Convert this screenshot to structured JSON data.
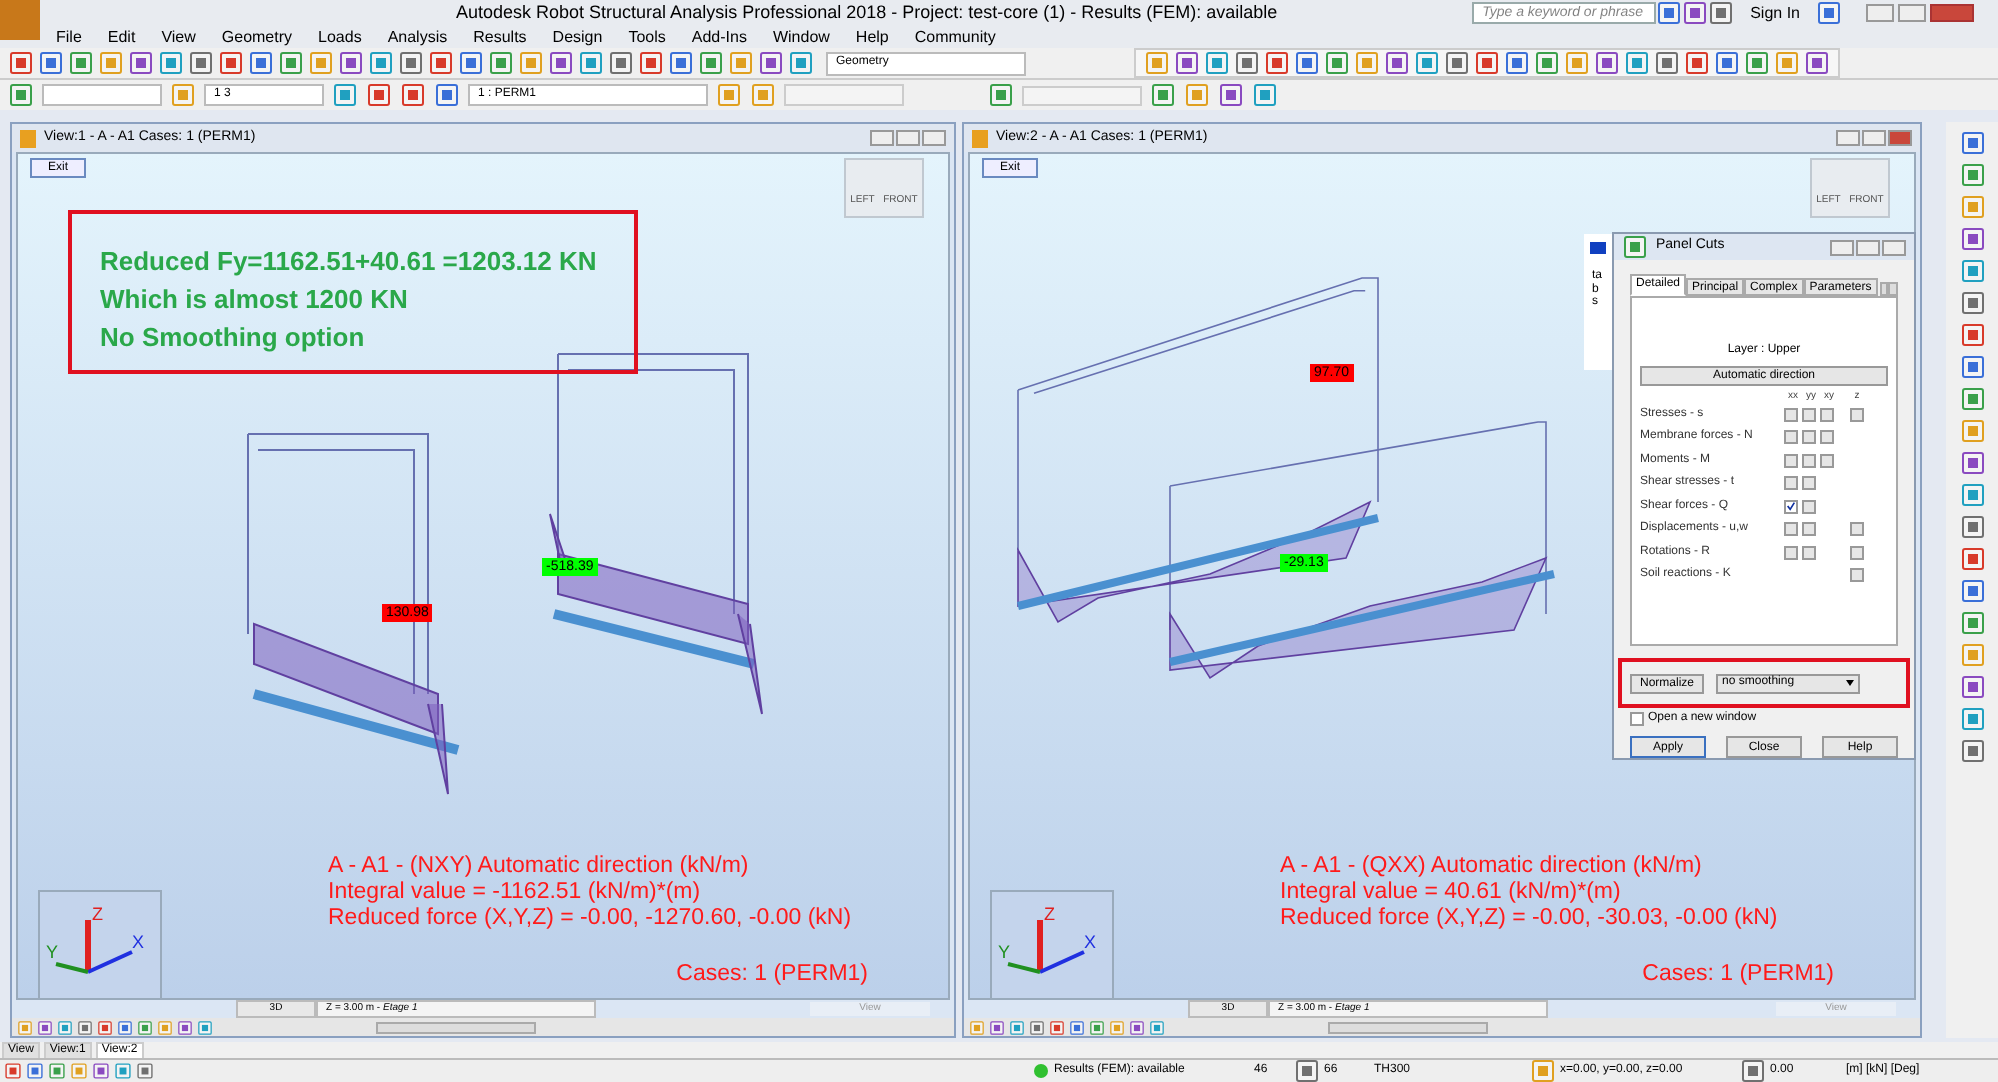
{
  "window": {
    "title": "Autodesk Robot Structural Analysis Professional 2018 - Project: test-core (1) - Results (FEM): available",
    "search_placeholder": "Type a keyword or phrase",
    "sign_in": "Sign In"
  },
  "menu": [
    "File",
    "Edit",
    "View",
    "Geometry",
    "Loads",
    "Analysis",
    "Results",
    "Design",
    "Tools",
    "Add-Ins",
    "Window",
    "Help",
    "Community"
  ],
  "toolbar": {
    "layout": "Geometry",
    "bar_combo": "1 3",
    "case_combo": "1 : PERM1"
  },
  "views": [
    {
      "title": "View:1 - A - A1 Cases: 1 (PERM1)",
      "exit": "Exit",
      "cube": [
        "LEFT",
        "FRONT"
      ],
      "annotation": [
        "Reduced Fy=1162.51+40.61 =1203.12 KN",
        "Which is almost 1200 KN",
        "No Smoothing option"
      ],
      "value_labels": [
        {
          "text": "130.98",
          "color": "#ff0000"
        },
        {
          "text": "-518.39",
          "color": "#00ff00"
        }
      ],
      "results": [
        "A - A1 - (NXY) Automatic direction (kN/m)",
        "Integral value = -1162.51 (kN/m)*(m)",
        "Reduced force (X,Y,Z) = -0.00, -1270.60, -0.00 (kN)"
      ],
      "cases": "Cases: 1 (PERM1)",
      "axes": [
        "X",
        "Y",
        "Z"
      ],
      "mode": "3D",
      "level": "Z = 3.00 m - *Etage 1*",
      "view_label": "View"
    },
    {
      "title": "View:2 - A - A1 Cases: 1 (PERM1)",
      "exit": "Exit",
      "cube": [
        "LEFT",
        "FRONT"
      ],
      "value_labels": [
        {
          "text": "97.70",
          "color": "#ff0000"
        },
        {
          "text": "-29.13",
          "color": "#00ff00"
        }
      ],
      "results": [
        "A - A1 - (QXX) Automatic direction (kN/m)",
        "Integral value = 40.61 (kN/m)*(m)",
        "Reduced force (X,Y,Z) = -0.00, -30.03, -0.00 (kN)"
      ],
      "cases": "Cases: 1 (PERM1)",
      "axes": [
        "X",
        "Y",
        "Z"
      ],
      "mode": "3D",
      "level": "Z = 3.00 m - *Etage 1*",
      "view_label": "View"
    }
  ],
  "panel_cuts": {
    "title": "Panel Cuts",
    "side_tab": "tabs",
    "tabs": [
      {
        "label": "Detailed",
        "selected": true
      },
      {
        "label": "Principal",
        "selected": false
      },
      {
        "label": "Complex",
        "selected": false
      },
      {
        "label": "Parameters",
        "selected": false
      }
    ],
    "layer": "Layer : Upper",
    "auto_button": "Automatic direction",
    "columns": [
      "xx",
      "yy",
      "xy",
      "z"
    ],
    "rows": [
      {
        "label": "Stresses - s",
        "cells": [
          {
            "checked": false
          },
          {
            "checked": false
          },
          {
            "checked": false
          },
          {
            "checked": false
          }
        ]
      },
      {
        "label": "Membrane forces - N",
        "cells": [
          {
            "checked": false
          },
          {
            "checked": false
          },
          {
            "checked": false
          },
          null
        ]
      },
      {
        "label": "Moments - M",
        "cells": [
          {
            "checked": false
          },
          {
            "checked": false
          },
          {
            "checked": false
          },
          null
        ]
      },
      {
        "label": "Shear stresses - t",
        "cells": [
          {
            "checked": false
          },
          {
            "checked": false
          },
          null,
          null
        ]
      },
      {
        "label": "Shear forces - Q",
        "cells": [
          {
            "checked": true
          },
          {
            "checked": false
          },
          null,
          null
        ]
      },
      {
        "label": "Displacements - u,w",
        "cells": [
          {
            "checked": false
          },
          {
            "checked": false
          },
          null,
          {
            "checked": false
          }
        ]
      },
      {
        "label": "Rotations - R",
        "cells": [
          {
            "checked": false
          },
          {
            "checked": false
          },
          null,
          {
            "checked": false
          }
        ]
      },
      {
        "label": "Soil reactions - K",
        "cells": [
          null,
          null,
          null,
          {
            "checked": false
          }
        ]
      }
    ],
    "normalize": "Normalize",
    "smoothing": "no smoothing",
    "open_new_window": {
      "label": "Open a new window",
      "checked": false
    },
    "buttons": [
      "Apply",
      "Close",
      "Help"
    ]
  },
  "view_tabs": [
    {
      "label": "View",
      "selected": false
    },
    {
      "label": "View:1",
      "selected": false
    },
    {
      "label": "View:2",
      "selected": true
    }
  ],
  "status_bar": {
    "results": "Results (FEM): available",
    "nodes": "46",
    "panels": "66",
    "section": "TH300",
    "coords": "x=0.00, y=0.00, z=0.00",
    "angle": "0.00",
    "units": "[m] [kN] [Deg]"
  }
}
